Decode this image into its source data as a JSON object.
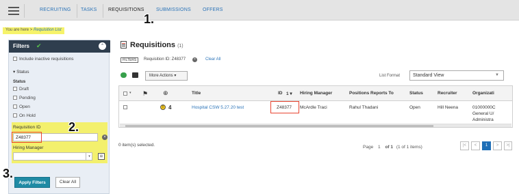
{
  "nav": {
    "items": [
      "RECRUITING",
      "TASKS",
      "REQUISITIONS",
      "SUBMISSIONS",
      "OFFERS"
    ]
  },
  "breadcrumb": {
    "prefix": "You are here >",
    "current": "Requisition List"
  },
  "filters": {
    "title": "Filters",
    "include_inactive": "Include inactive requisitions",
    "status_toggle": "▾ Status",
    "status_label": "Status",
    "statuses": [
      "Draft",
      "Pending",
      "Open",
      "On Hold"
    ],
    "requisition_id_label": "Requisition ID",
    "requisition_id_value": "Z48377",
    "hiring_manager_label": "Hiring Manager",
    "hiring_manager_value": "",
    "apply_label": "Apply Filters",
    "clear_label": "Clear All"
  },
  "steps": [
    "1.",
    "2.",
    "3."
  ],
  "main": {
    "title": "Requisitions",
    "count": "(1)",
    "filter_tag": "FILTERS",
    "active_filter": "Requisition ID: Z48377",
    "clear_all": "Clear All",
    "more_actions": "More Actions ▾",
    "list_format_label": "List Format",
    "list_format_value": "Standard View"
  },
  "table": {
    "headers": [
      "Title",
      "ID",
      "Hiring Manager",
      "Positions Reports To",
      "Status",
      "Recruiter",
      "Organizati"
    ],
    "id_sort": "1 ▾",
    "row": {
      "alert_count": "4",
      "title": "Hospital CSW 5.27.20 test",
      "id": "Z48377",
      "hiring_manager": "McArdle Traci",
      "reports_to": "Rahul Thadani",
      "status": "Open",
      "recruiter": "Hill Neena",
      "org_line1": "01000000C",
      "org_line2": "General U/",
      "org_line3": "Administra"
    }
  },
  "footer": {
    "selected": "0 item(s) selected.",
    "page_word": "Page",
    "page_num": "1",
    "of_text": "of 1",
    "items_text": "(1 of 1 items)",
    "current_page": "1"
  },
  "colors": {
    "accent": "#1f8aa4",
    "highlight": "#f3f06d",
    "annotation": "#e8432f",
    "link": "#2a73b8"
  }
}
